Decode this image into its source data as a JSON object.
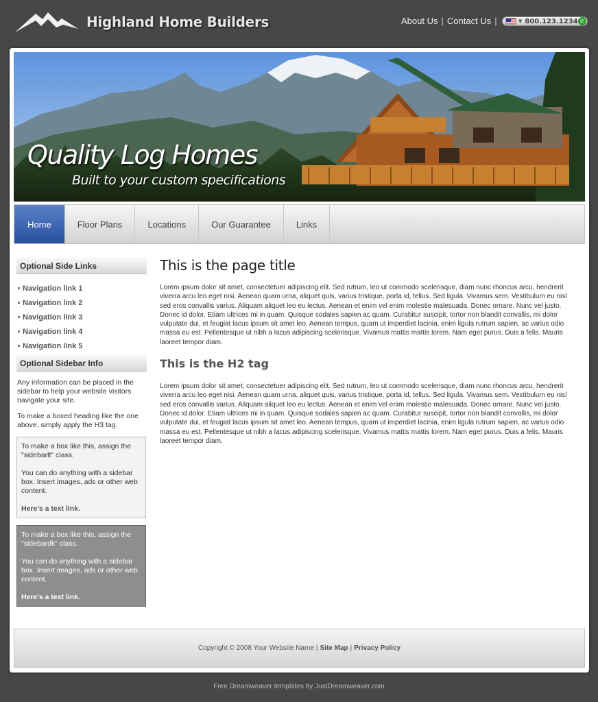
{
  "header": {
    "site_name": "Highland Home Builders",
    "links": [
      "About Us",
      "Contact Us"
    ],
    "phone": "800.123.1234"
  },
  "banner": {
    "title": "Quality Log Homes",
    "subtitle": "Built to your custom specifications"
  },
  "nav": {
    "items": [
      "Home",
      "Floor Plans",
      "Locations",
      "Our Guarantee",
      "Links"
    ],
    "active": "Home"
  },
  "sidebar": {
    "links_heading": "Optional Side Links",
    "links": [
      "Navigation link 1",
      "Navigation link 2",
      "Navigation link 3",
      "Navigation link 4",
      "Navigation link 5"
    ],
    "info_heading": "Optional Sidebar Info",
    "info_text_1": "Any information can be placed in the sidebar to help your website visitors navigate your site.",
    "info_text_2": "To make a boxed heading like the one above, simply apply the H3 tag.",
    "box_light": {
      "text_1": "To make a box like this, assign the \"sidebarlt\" class.",
      "text_2": "You can do anything with a sidebar box. Insert images, ads or other web content.",
      "link": "Here's a text link."
    },
    "box_dark": {
      "text_1": "To make a box like this, assign the \"sidebardk\" class.",
      "text_2": "You can do anything with a sidebar box. Insert images, ads or other web content.",
      "link": "Here's a text link."
    }
  },
  "content": {
    "title": "This is the page title",
    "para_1": "Lorem ipsum dolor sit amet, consectetuer adipiscing elit. Sed rutrum, leo ut commodo scelerisque, diam nunc rhoncus arcu, hendrerit viverra arcu leo eget nisi. Aenean quam urna, aliquet quis, varius tristique, porta id, tellus. Sed ligula. Vivamus sem. Vestibulum eu nisl sed eros convallis varius. Aliquam aliquet leo eu lectus. Aenean et enim vel enim molestie malesuada. Donec ornare. Nunc vel justo. Donec id dolor. Etiam ultrices mi in quam. Quisque sodales sapien ac quam. Curabitur suscipit, tortor non blandit convallis, mi dolor vulputate dui, et feugiat lacus ipsum sit amet leo. Aenean tempus, quam ut imperdiet lacinia, enim ligula rutrum sapien, ac varius odio massa eu est. Pellentesque ut nibh a lacus adipiscing scelerisque. Vivamus mattis mattis lorem. Nam eget purus. Duis a felis. Mauris laoreet tempor diam.",
    "h2": "This is the H2 tag",
    "para_2": "Lorem ipsum dolor sit amet, consectetuer adipiscing elit. Sed rutrum, leo ut commodo scelerisque, diam nunc rhoncus arcu, hendrerit viverra arcu leo eget nisi. Aenean quam urna, aliquet quis, varius tristique, porta id, tellus. Sed ligula. Vivamus sem. Vestibulum eu nisl sed eros convallis varius. Aliquam aliquet leo eu lectus. Aenean et enim vel enim molestie malesuada. Donec ornare. Nunc vel justo. Donec id dolor. Etiam ultrices mi in quam. Quisque sodales sapien ac quam. Curabitur suscipit, tortor non blandit convallis, mi dolor vulputate dui, et feugiat lacus ipsum sit amet leo. Aenean tempus, quam ut imperdiet lacinia, enim ligula rutrum sapien, ac varius odio massa eu est. Pellentesque ut nibh a lacus adipiscing scelerisque. Vivamus mattis mattis lorem. Nam eget purus. Duis a felis. Mauris laoreet tempor diam."
  },
  "footer": {
    "copyright": "Copyright © 2008 Your Website Name",
    "links": [
      "Site Map",
      "Privacy Policy"
    ],
    "credit": "Free Dreamweaver templates by JustDreamweaver.com"
  },
  "icons": {
    "logo": "mountain-logo-icon",
    "flag": "us-flag-icon",
    "phone": "phone-icon"
  }
}
